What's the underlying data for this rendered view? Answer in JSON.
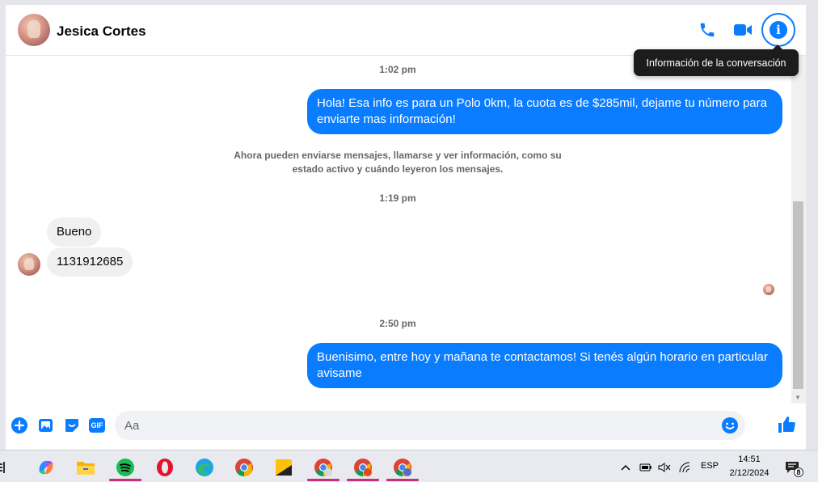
{
  "header": {
    "contact_name": "Jesica Cortes",
    "tooltip": "Información de la conversación"
  },
  "messages": {
    "ts1": "1:02 pm",
    "out1": "Hola! Esa info es para un Polo 0km, la cuota es de $285mil, dejame tu número para enviarte mas información!",
    "system": "Ahora pueden enviarse mensajes, llamarse y ver información, como su estado activo y cuándo leyeron los mensajes.",
    "ts2": "1:19 pm",
    "in1": "Bueno",
    "in2": "1131912685",
    "ts3": "2:50 pm",
    "out2": "Buenisimo, entre hoy y mañana te contactamos! Si tenés algún horario en particular avisame"
  },
  "composer": {
    "placeholder": "Aa",
    "gif_label": "GIF"
  },
  "taskbar": {
    "language": "ESP",
    "time": "14:51",
    "date": "2/12/2024",
    "notification_count": "8"
  },
  "colors": {
    "accent": "#0a7cff",
    "outgoing_bubble": "#0a7cff",
    "incoming_bubble": "#f0f0f0"
  }
}
